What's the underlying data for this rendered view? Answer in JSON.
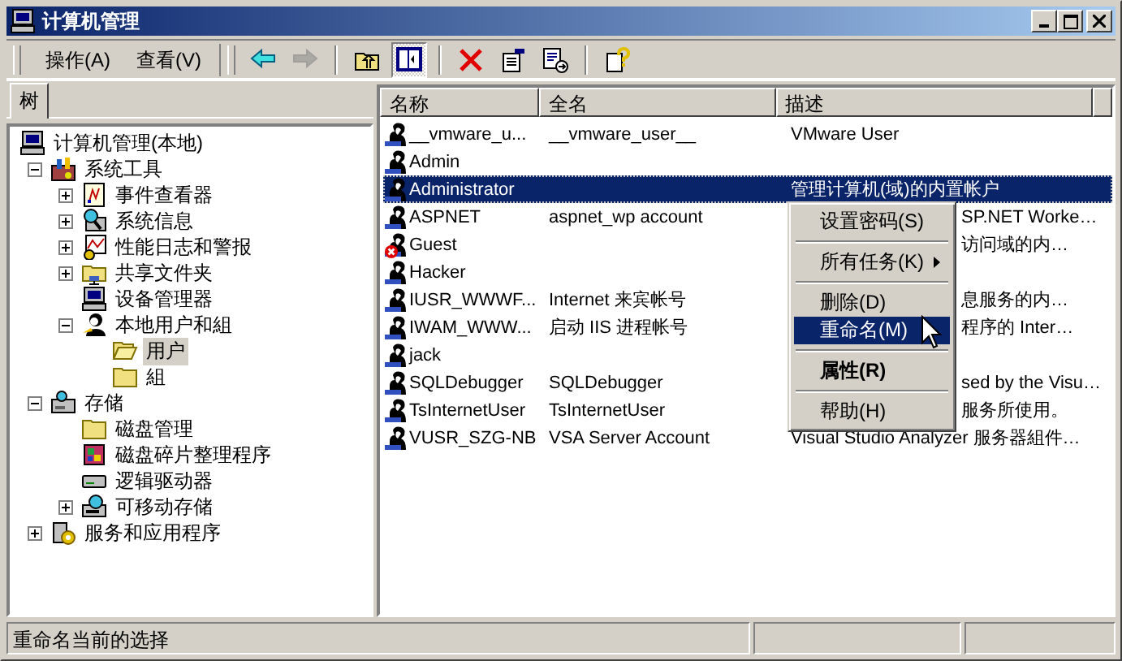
{
  "window": {
    "title": "计算机管理"
  },
  "menu_bar": [
    {
      "label": "操作(A)"
    },
    {
      "label": "查看(V)"
    }
  ],
  "toolbar": [
    {
      "kind": "back",
      "disabled": false,
      "pressed": false
    },
    {
      "kind": "forward",
      "disabled": true,
      "pressed": false
    },
    {
      "kind": "separator"
    },
    {
      "kind": "up",
      "disabled": false,
      "pressed": false
    },
    {
      "kind": "tree",
      "disabled": false,
      "pressed": true
    },
    {
      "kind": "separator"
    },
    {
      "kind": "delete",
      "disabled": false,
      "pressed": false
    },
    {
      "kind": "properties",
      "disabled": false,
      "pressed": false
    },
    {
      "kind": "export",
      "disabled": false,
      "pressed": false
    },
    {
      "kind": "separator"
    },
    {
      "kind": "help",
      "disabled": false,
      "pressed": false
    }
  ],
  "tree": {
    "tab": "树",
    "nodes": [
      {
        "label": "计算机管理(本地)",
        "kind": "computer",
        "selected": false,
        "children": [
          {
            "label": "系统工具",
            "kind": "tools",
            "expanded": true,
            "selected": false,
            "children": [
              {
                "label": "事件查看器",
                "kind": "log",
                "expanded": false,
                "selected": false
              },
              {
                "label": "系统信息",
                "kind": "info",
                "expanded": false,
                "selected": false
              },
              {
                "label": "性能日志和警报",
                "kind": "chart",
                "expanded": false,
                "selected": false
              },
              {
                "label": "共享文件夹",
                "kind": "share",
                "expanded": false,
                "selected": false
              },
              {
                "label": "设备管理器",
                "kind": "computer",
                "selected": false
              },
              {
                "label": "本地用户和組",
                "kind": "users",
                "expanded": true,
                "selected": false,
                "children": [
                  {
                    "label": "用户",
                    "kind": "folder-open",
                    "selected": true
                  },
                  {
                    "label": "組",
                    "kind": "folder",
                    "selected": false
                  }
                ]
              }
            ]
          },
          {
            "label": "存储",
            "kind": "storage",
            "expanded": true,
            "selected": false,
            "children": [
              {
                "label": "磁盘管理",
                "kind": "folder",
                "selected": false
              },
              {
                "label": "磁盘碎片整理程序",
                "kind": "defrag",
                "selected": false
              },
              {
                "label": "逻辑驱动器",
                "kind": "drive",
                "selected": false
              },
              {
                "label": "可移动存储",
                "kind": "removable",
                "expanded": false,
                "selected": false
              }
            ]
          },
          {
            "label": "服务和应用程序",
            "kind": "services",
            "expanded": false,
            "selected": false
          }
        ]
      }
    ]
  },
  "list": {
    "columns": [
      "名称",
      "全名",
      "描述"
    ],
    "rows": [
      {
        "name": "__vmware_u...",
        "full_name": "__vmware_user__",
        "description": "VMware User",
        "disabled": false,
        "selected": false
      },
      {
        "name": "Admin",
        "disabled": false,
        "selected": false
      },
      {
        "name": "Administrator",
        "description": "管理计算机(域)的内置帐户",
        "disabled": false,
        "selected": true
      },
      {
        "name": "ASPNET",
        "full_name": "aspnet_wp account",
        "description": "SP.NET Worke…",
        "disabled": false,
        "selected": false
      },
      {
        "name": "Guest",
        "description": "访问域的内…",
        "disabled": true,
        "selected": false
      },
      {
        "name": "Hacker",
        "disabled": false,
        "selected": false
      },
      {
        "name": "IUSR_WWWF...",
        "full_name": "Internet 来宾帐号",
        "description": "息服务的内…",
        "disabled": false,
        "selected": false
      },
      {
        "name": "IWAM_WWW...",
        "full_name": "启动 IIS 进程帐号",
        "description": "程序的 Inter…",
        "disabled": false,
        "selected": false
      },
      {
        "name": "jack",
        "disabled": false,
        "selected": false
      },
      {
        "name": "SQLDebugger",
        "full_name": "SQLDebugger",
        "description": "sed by the Visu…",
        "disabled": false,
        "selected": false
      },
      {
        "name": "TsInternetUser",
        "full_name": "TsInternetUser",
        "description": "服务所使用。",
        "disabled": false,
        "selected": false
      },
      {
        "name": "VUSR_SZG-NB",
        "full_name": "VSA Server Account",
        "description": "Visual Studio Analyzer 服务器組件…",
        "disabled": false,
        "selected": false
      }
    ]
  },
  "context_menu": [
    {
      "kind": "item",
      "label": "设置密码(S)",
      "submenu": false,
      "default": false,
      "selected": false
    },
    {
      "kind": "separator"
    },
    {
      "kind": "item",
      "label": "所有任务(K)",
      "submenu": true,
      "default": false,
      "selected": false
    },
    {
      "kind": "separator"
    },
    {
      "kind": "item",
      "label": "删除(D)",
      "submenu": false,
      "default": false,
      "selected": false
    },
    {
      "kind": "item",
      "label": "重命名(M)",
      "submenu": false,
      "default": false,
      "selected": true
    },
    {
      "kind": "separator"
    },
    {
      "kind": "item",
      "label": "属性(R)",
      "submenu": false,
      "default": true,
      "selected": false
    },
    {
      "kind": "separator"
    },
    {
      "kind": "item",
      "label": "帮助(H)",
      "submenu": false,
      "default": false,
      "selected": false
    }
  ],
  "status_bar": {
    "text": "重命名当前的选择"
  }
}
